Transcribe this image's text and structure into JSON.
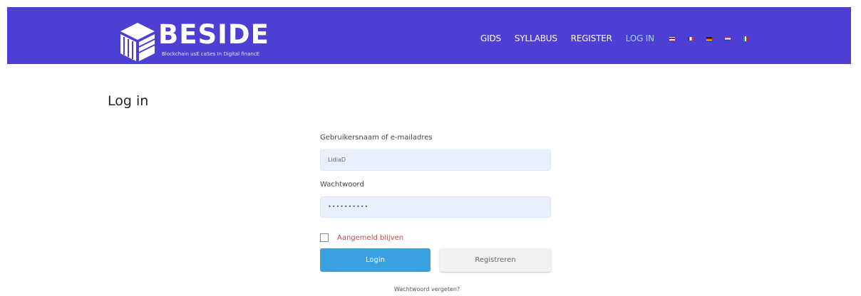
{
  "brand": {
    "name": "BESIDE",
    "tagline": "Blockchain usE caSes In Digital financE"
  },
  "nav": {
    "items": [
      {
        "label": "GIDS"
      },
      {
        "label": "SYLLABUS"
      },
      {
        "label": "REGISTER"
      },
      {
        "label": "LOG IN"
      }
    ],
    "flags": [
      "uk-flag-icon",
      "fr-flag-icon",
      "de-flag-icon",
      "nl-flag-icon",
      "it-flag-icon"
    ]
  },
  "page": {
    "title": "Log in"
  },
  "form": {
    "username_label": "Gebruikersnaam of e-mailadres",
    "username_value": "LidiaD",
    "password_label": "Wachtwoord",
    "password_value": "••••••••••",
    "remember_label": "Aangemeld blijven",
    "login_label": "Login",
    "register_label": "Registreren",
    "forgot_label": "Wachtwoord vergeten?"
  },
  "colors": {
    "header_bg": "#4d3fd4",
    "active_nav": "#9ad6ff",
    "login_button": "#3aa0df"
  }
}
